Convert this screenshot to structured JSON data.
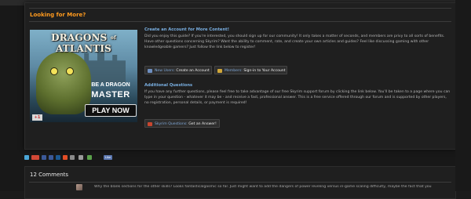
{
  "section": {
    "title": "Looking for More?"
  },
  "ad": {
    "logo_word1": "DRAGONS",
    "logo_of": "of",
    "logo_word2": "ATLANTIS",
    "line1": "BE A DRAGON",
    "line2": "MASTER",
    "play_label": "PLAY NOW",
    "gplus_label": "+1"
  },
  "create_account": {
    "heading": "Create an Account for More Content!",
    "body": "Did you enjoy this guide? If you're interested, you should sign up for our community! It only takes a matter of seconds, and members are privy to all sorts of benefits. Have other questions concerning Skyrim? Want the ability to comment, rate, and create your own articles and guides? Feel like discussing gaming with other knowledgeable gamers? Just follow the link below to register!",
    "new_users_prefix": "New Users:",
    "new_users_label": "Create an Account",
    "members_prefix": "Members:",
    "members_label": "Sign-in to Your Account"
  },
  "additional_questions": {
    "heading": "Additional Questions",
    "body": "If you have any further questions, please feel free to take advantage of our free Skyrim support forum by clicking the link below. You'll be taken to a page where you can type in your question - whatever it may be - and receive a fast, professional answer. This is a free service offered through our forum and is supported by other players, no registration, personal details, or payment is required!",
    "button_prefix": "Skyrim Questions:",
    "button_label": "Get an Answer!"
  },
  "share": {
    "icons": [
      "twitter-icon",
      "google-plus-icon",
      "myspace-icon",
      "facebook-icon",
      "digg-icon",
      "stumbleupon-icon",
      "email-icon",
      "print-icon",
      "share-icon"
    ],
    "like_label": "Like",
    "colors": {
      "twitter": "#4aa6d8",
      "gplus": "#d14836",
      "myspace": "#3b5998",
      "facebook": "#3b5998",
      "digg": "#1b5891",
      "stumble": "#e34d26",
      "email": "#8a8a8a",
      "print": "#9a9a9a",
      "share": "#5aa04a"
    }
  },
  "comments": {
    "title": "12 Comments",
    "first_text": "Why the blank sections for the other skills? Looks fantasticalgasmic so far. Just might want to add the dangers of power leveling versus in-game scaling difficulty, maybe the fact that you"
  },
  "colors": {
    "accent_orange": "#ff9a1e",
    "heading_blue": "#79aee0",
    "panel_bg": "#1f1f1f",
    "page_bg": "#181818"
  }
}
